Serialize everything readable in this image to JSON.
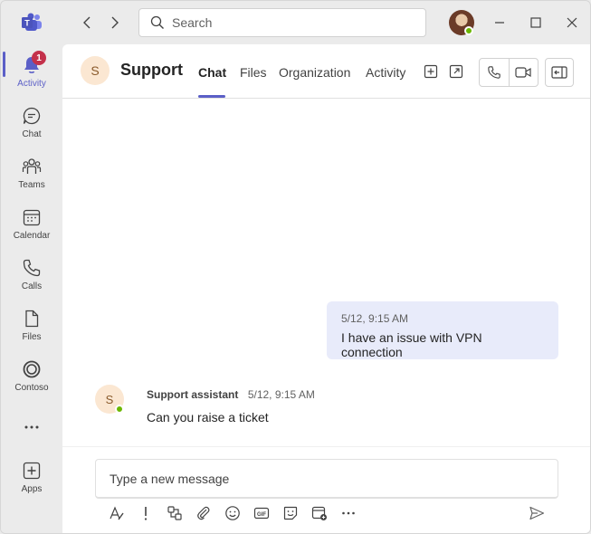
{
  "titlebar": {
    "search_placeholder": "Search"
  },
  "rail": {
    "items": [
      {
        "label": "Activity",
        "icon": "bell-icon",
        "badge": "1",
        "active": true
      },
      {
        "label": "Chat",
        "icon": "chat-icon"
      },
      {
        "label": "Teams",
        "icon": "teams-icon"
      },
      {
        "label": "Calendar",
        "icon": "calendar-icon"
      },
      {
        "label": "Calls",
        "icon": "phone-icon"
      },
      {
        "label": "Files",
        "icon": "file-icon"
      },
      {
        "label": "Contoso",
        "icon": "contoso-icon"
      },
      {
        "label": "",
        "icon": "more-icon"
      },
      {
        "label": "Apps",
        "icon": "apps-icon"
      }
    ]
  },
  "header": {
    "avatar_initial": "S",
    "title": "Support",
    "tabs": [
      "Chat",
      "Files",
      "Organization",
      "Activity"
    ],
    "active_tab": "Chat"
  },
  "messages": {
    "outgoing": {
      "time": "5/12, 9:15 AM",
      "text": "I have an issue with VPN connection"
    },
    "incoming": {
      "avatar_initial": "S",
      "sender": "Support assistant",
      "time": "5/12, 9:15 AM",
      "text": "Can you raise a ticket"
    }
  },
  "compose": {
    "placeholder": "Type a new message"
  },
  "colors": {
    "accent": "#5b5fc7",
    "badge": "#c4314b",
    "presence": "#6bb700",
    "outgoing_bubble": "#e8ebfa"
  }
}
